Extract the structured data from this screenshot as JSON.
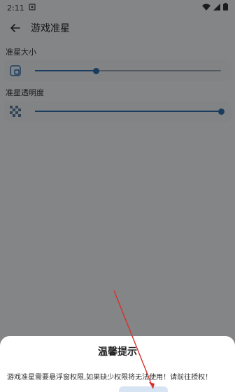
{
  "status_bar": {
    "time": "2:11"
  },
  "app_bar": {
    "title": "游戏准星"
  },
  "settings": {
    "size_label": "准星大小",
    "size_value": 0.33,
    "opacity_label": "准星透明度",
    "opacity_value": 1.0
  },
  "dialog": {
    "title": "温馨提示",
    "message": "游戏准星需要悬浮窗权限,如果缺少权限将无法使用！请前往授权！"
  },
  "colors": {
    "accent": "#2f6fb0",
    "annotation_arrow": "#d9302a"
  }
}
